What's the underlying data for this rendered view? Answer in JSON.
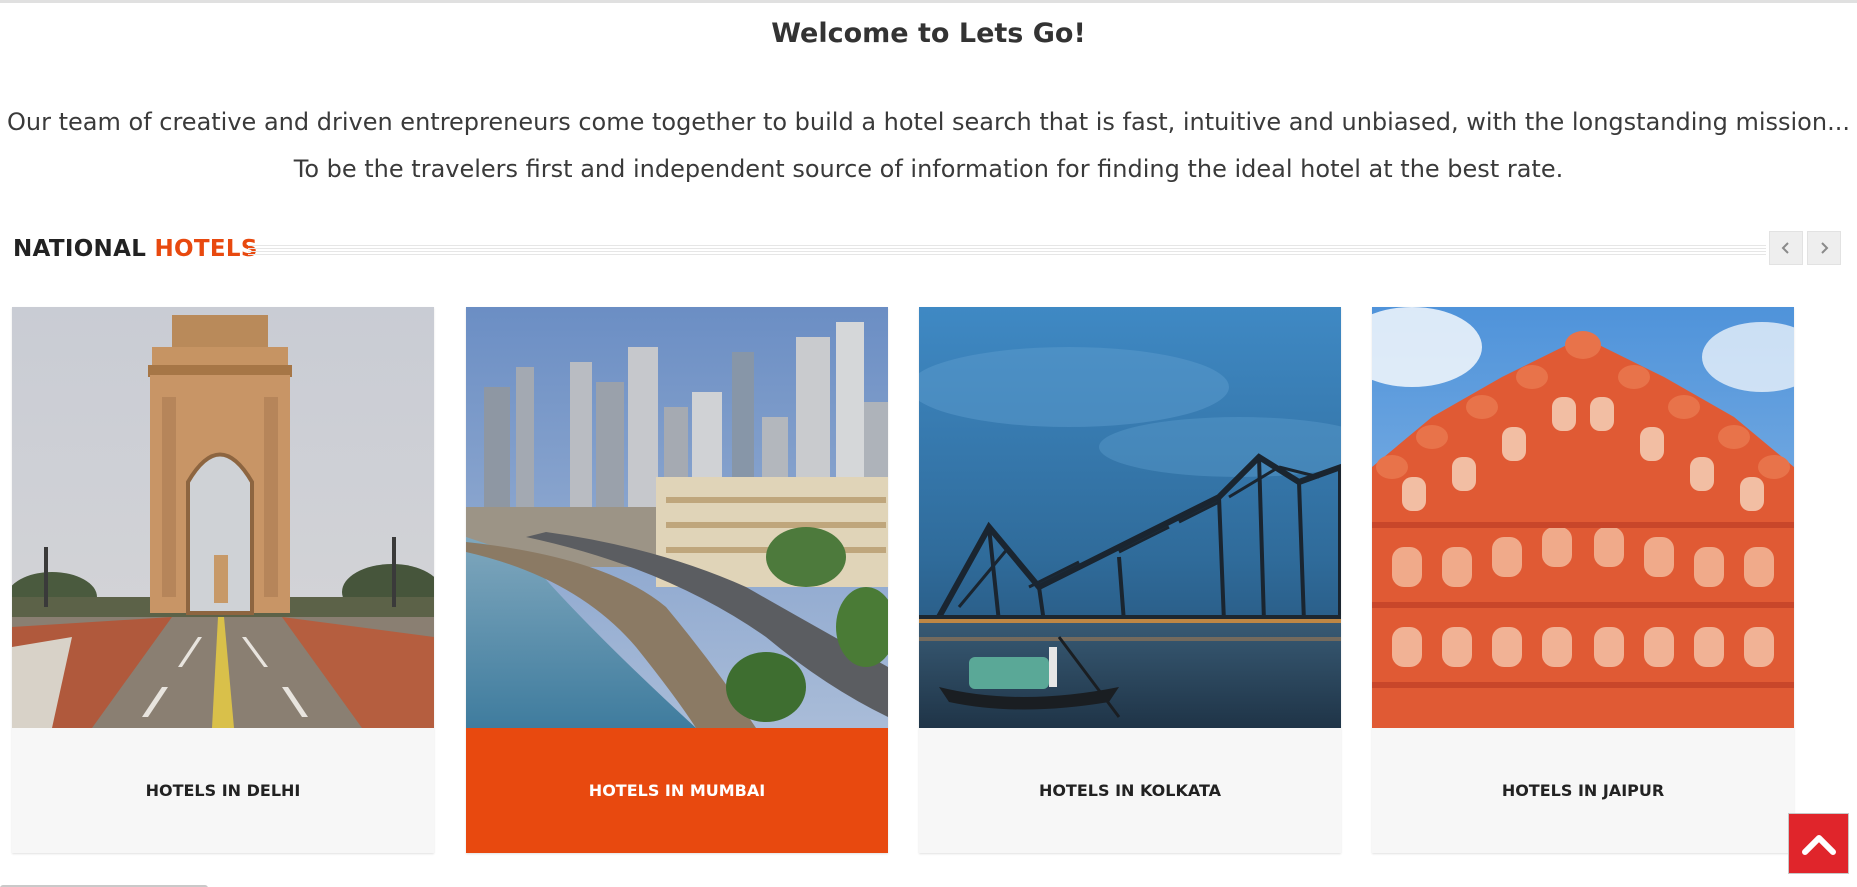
{
  "welcome": {
    "title": "Welcome to Lets Go!",
    "line1": "Our team of creative and driven entrepreneurs come together to build a hotel search that is fast, intuitive and unbiased, with the longstanding mission...",
    "line2": "To be the travelers first and independent source of information for finding the ideal hotel at the best rate."
  },
  "section": {
    "title_plain": "NATIONAL",
    "title_accent": "HOTELS",
    "prev_icon": "chevron-left-icon",
    "next_icon": "chevron-right-icon"
  },
  "cards": [
    {
      "label": "HOTELS IN DELHI",
      "image": "india-gate-photo",
      "active": false
    },
    {
      "label": "HOTELS IN MUMBAI",
      "image": "mumbai-marine-drive-photo",
      "active": true
    },
    {
      "label": "HOTELS IN KOLKATA",
      "image": "howrah-bridge-photo",
      "active": false
    },
    {
      "label": "HOTELS IN JAIPUR",
      "image": "hawa-mahal-photo",
      "active": false
    }
  ],
  "scroll_top": {
    "icon": "chevron-up-icon"
  },
  "colors": {
    "accent": "#e8490f",
    "scroll_top": "#e0252b",
    "card_bg": "#f7f7f7",
    "text": "#333333"
  }
}
